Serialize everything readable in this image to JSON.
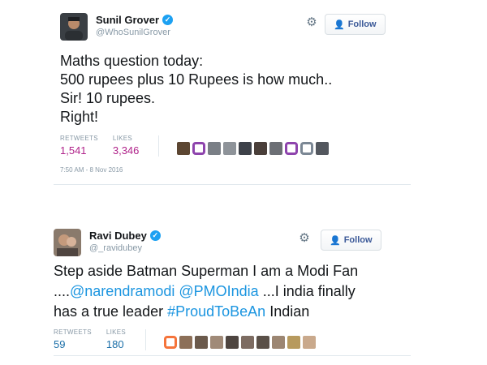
{
  "tweets": [
    {
      "author": {
        "name": "Sunil Grover",
        "handle": "@WhoSunilGrover"
      },
      "follow_label": "Follow",
      "text": "Maths question today:\n500 rupees plus 10 Rupees is how much..\nSir! 10 rupees.\nRight!",
      "stats": {
        "retweets_label": "RETWEETS",
        "retweets": "1,541",
        "likes_label": "LIKES",
        "likes": "3,346"
      },
      "timestamp": "7:50 AM - 8 Nov 2016"
    },
    {
      "author": {
        "name": "Ravi Dubey",
        "handle": "@_ravidubey"
      },
      "follow_label": "Follow",
      "text_parts": [
        {
          "text": "Step aside Batman Superman  I am a Modi Fan ....",
          "link": false
        },
        {
          "text": "@narendramodi",
          "link": true
        },
        {
          "text": " ",
          "link": false
        },
        {
          "text": "@PMOIndia",
          "link": true
        },
        {
          "text": " ...I india finally has a true leader ",
          "link": false
        },
        {
          "text": "#ProudToBeAn",
          "link": true
        },
        {
          "text": " Indian",
          "link": false
        }
      ],
      "stats": {
        "retweets_label": "RETWEETS",
        "retweets": "59",
        "likes_label": "LIKES",
        "likes": "180"
      }
    }
  ],
  "icons": {
    "verified": "verified-badge-icon",
    "gear": "gear-icon",
    "follow": "add-user-icon"
  },
  "colors": {
    "link": "#1b95e0",
    "verified": "#1da1f2",
    "count_tweet1": "#b0238a",
    "count_tweet2": "#1b6fa8"
  }
}
